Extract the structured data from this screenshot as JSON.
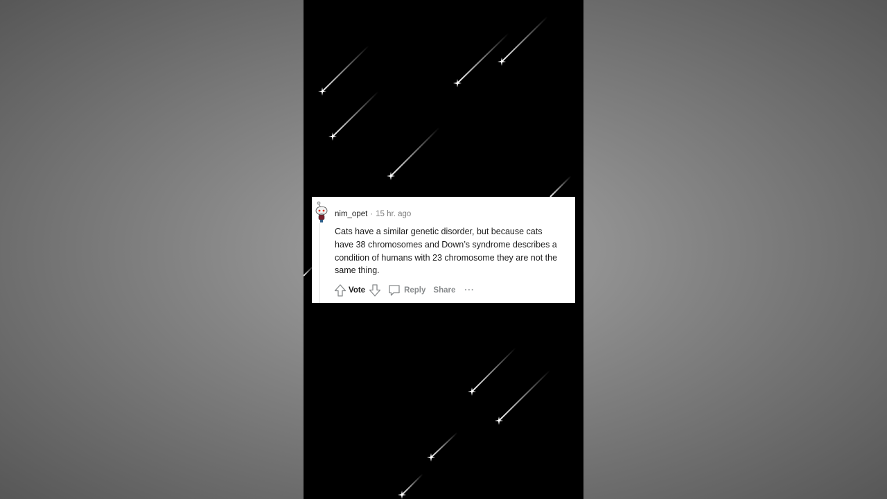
{
  "comment": {
    "username": "nim_opet",
    "separator": "·",
    "timestamp": "15 hr. ago",
    "body": "Cats have a similar genetic disorder, but because cats have 38 chromosomes and Down’s syndrome describes a condition of humans with 23 chromosome they are not the same thing.",
    "actions": {
      "vote": "Vote",
      "reply": "Reply",
      "share": "Share",
      "more": "···"
    }
  },
  "icons": {
    "upvote": "arrow-up-icon",
    "downvote": "arrow-down-icon",
    "reply": "speech-bubble-icon",
    "avatar": "snoo-avatar"
  },
  "colors": {
    "video_background": "#000000",
    "card_background": "#ffffff",
    "text_primary": "#1c1c1c",
    "text_muted": "#878a8c"
  }
}
